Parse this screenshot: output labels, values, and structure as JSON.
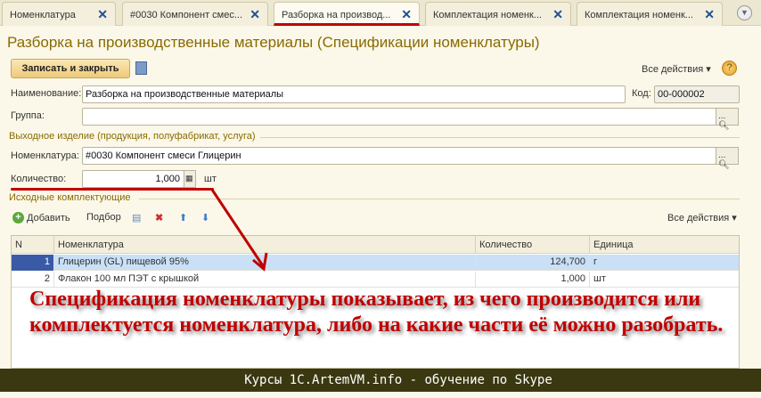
{
  "tabs": [
    {
      "label": "Номенклатура"
    },
    {
      "label": "#0030 Компонент смес..."
    },
    {
      "label": "Разборка на производ...",
      "active": true
    },
    {
      "label": "Комплектация номенк..."
    },
    {
      "label": "Комплектация номенк..."
    }
  ],
  "title": "Разборка на производственные материалы (Спецификации номенклатуры)",
  "toolbar": {
    "save_close": "Записать и закрыть",
    "all_actions": "Все действия ▾",
    "help": "?"
  },
  "form": {
    "name_label": "Наименование:",
    "name_value": "Разборка на производственные материалы",
    "code_label": "Код:",
    "code_value": "00-000002",
    "group_label": "Группа:",
    "group_value": "",
    "output_section": "Выходное изделие (продукция, полуфабрикат, услуга)",
    "nom_label": "Номенклатура:",
    "nom_value": "#0030 Компонент смеси Глицерин",
    "qty_label": "Количество:",
    "qty_value": "1,000",
    "unit": "шт",
    "select_btn": "...",
    "components_section": "Исходные комплектующие"
  },
  "table_toolbar": {
    "add": "Добавить",
    "pick": "Подбор",
    "all_actions": "Все действия ▾"
  },
  "table": {
    "columns": [
      "N",
      "Номенклатура",
      "Количество",
      "Единица"
    ],
    "rows": [
      {
        "n": "1",
        "nom": "Глицерин (GL) пищевой 95%",
        "qty": "124,700",
        "unit": "г"
      },
      {
        "n": "2",
        "nom": "Флакон 100 мл ПЭТ с крышкой",
        "qty": "1,000",
        "unit": "шт"
      }
    ]
  },
  "annotation": "Спецификация номенклатуры показывает, из чего производится или комплектуется номенклатура, либо на какие части её можно разобрать.",
  "banner": "Курсы 1C.ArtemVM.info - обучение по Skype",
  "colors": {
    "accent": "#8a6a00",
    "annotation": "#c00000",
    "banner": "#3a3810",
    "selected_row": "#c9e0f7"
  }
}
